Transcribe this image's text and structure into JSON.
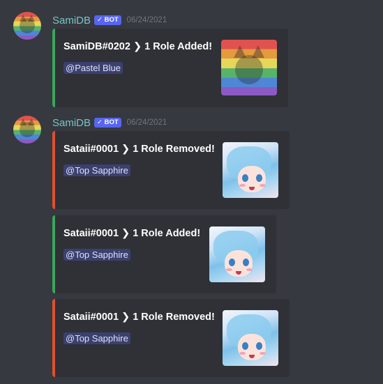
{
  "messages": [
    {
      "username": "SamiDB",
      "bot_tag": "✓ BOT",
      "timestamp": "06/24/2021",
      "embeds": [
        {
          "title": "SamiDB#0202 ❯ 1 Role Added!",
          "mention": "@Pastel Blue",
          "color": "#3ba55d",
          "thumbnail": "rainbow-cat-avatar"
        }
      ]
    },
    {
      "username": "SamiDB",
      "bot_tag": "✓ BOT",
      "timestamp": "06/24/2021",
      "embeds": [
        {
          "title": "Sataii#0001 ❯ 1 Role Removed!",
          "mention": "@Top Sapphire",
          "color": "#e0502d",
          "thumbnail": "anime-girl-avatar"
        },
        {
          "title": "Sataii#0001 ❯ 1 Role Added!",
          "mention": "@Top Sapphire",
          "color": "#3ba55d",
          "thumbnail": "anime-girl-avatar"
        },
        {
          "title": "Sataii#0001 ❯ 1 Role Removed!",
          "mention": "@Top Sapphire",
          "color": "#e0502d",
          "thumbnail": "anime-girl-avatar"
        }
      ]
    }
  ],
  "theme": {
    "background": "#36393f",
    "embed_background": "#2f3136",
    "username_color": "#77c5c7",
    "bot_tag_color": "#5865f2"
  }
}
